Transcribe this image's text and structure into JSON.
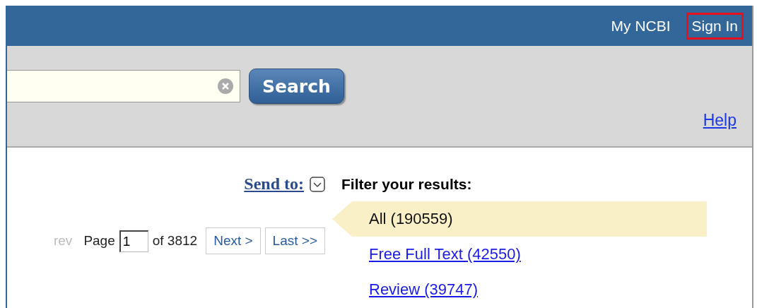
{
  "header": {
    "links": [
      {
        "label": "My NCBI",
        "highlighted": false
      },
      {
        "label": "Sign In",
        "highlighted": true
      }
    ]
  },
  "search": {
    "button": "Search"
  },
  "help": "Help",
  "send_to": {
    "label": "Send to:"
  },
  "pager": {
    "prev": {
      "label": "rev",
      "disabled": true
    },
    "page_label": "Page",
    "page": "1",
    "of": "of 3812",
    "buttons": [
      "Next >",
      "Last >>"
    ]
  },
  "filters": {
    "title": "Filter your results:",
    "items": [
      {
        "label": "All (190559)",
        "selected": true
      },
      {
        "label": "Free Full Text (42550)",
        "selected": false
      },
      {
        "label": "Review (39747)",
        "selected": false
      }
    ]
  }
}
